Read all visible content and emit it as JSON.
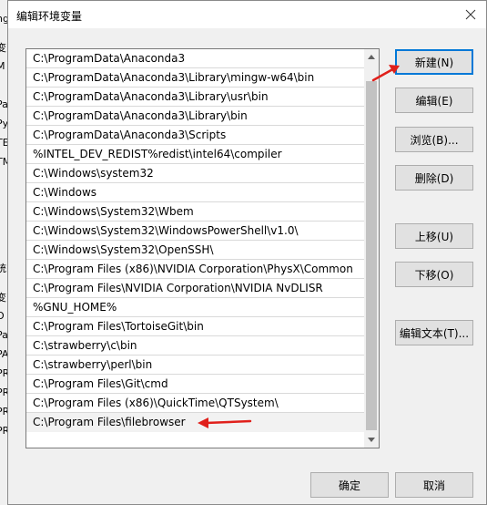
{
  "dialog": {
    "title": "编辑环境变量",
    "close_symbol": "✕"
  },
  "paths": [
    "C:\\ProgramData\\Anaconda3",
    "C:\\ProgramData\\Anaconda3\\Library\\mingw-w64\\bin",
    "C:\\ProgramData\\Anaconda3\\Library\\usr\\bin",
    "C:\\ProgramData\\Anaconda3\\Library\\bin",
    "C:\\ProgramData\\Anaconda3\\Scripts",
    "%INTEL_DEV_REDIST%redist\\intel64\\compiler",
    "C:\\Windows\\system32",
    "C:\\Windows",
    "C:\\Windows\\System32\\Wbem",
    "C:\\Windows\\System32\\WindowsPowerShell\\v1.0\\",
    "C:\\Windows\\System32\\OpenSSH\\",
    "C:\\Program Files (x86)\\NVIDIA Corporation\\PhysX\\Common",
    "C:\\Program Files\\NVIDIA Corporation\\NVIDIA NvDLISR",
    "%GNU_HOME%",
    "C:\\Program Files\\TortoiseGit\\bin",
    "C:\\strawberry\\c\\bin",
    "C:\\strawberry\\perl\\bin",
    "C:\\Program Files\\Git\\cmd",
    "C:\\Program Files (x86)\\QuickTime\\QTSystem\\",
    "C:\\Program Files\\filebrowser"
  ],
  "buttons": {
    "new": "新建(N)",
    "edit": "编辑(E)",
    "browse": "浏览(B)...",
    "delete": "删除(D)",
    "move_up": "上移(U)",
    "move_down": "下移(O)",
    "edit_text": "编辑文本(T)...",
    "ok": "确定",
    "cancel": "取消"
  },
  "background_window": {
    "fragments": [
      "ng",
      "变",
      "M",
      "Pa",
      "Py",
      "TE",
      "TM",
      "统",
      "变",
      "O",
      "Pa",
      "PA",
      "PR",
      "PR",
      "PR",
      "PR"
    ]
  },
  "colors": {
    "annotation_arrow": "#e0201b",
    "default_button_border": "#0078d7"
  }
}
